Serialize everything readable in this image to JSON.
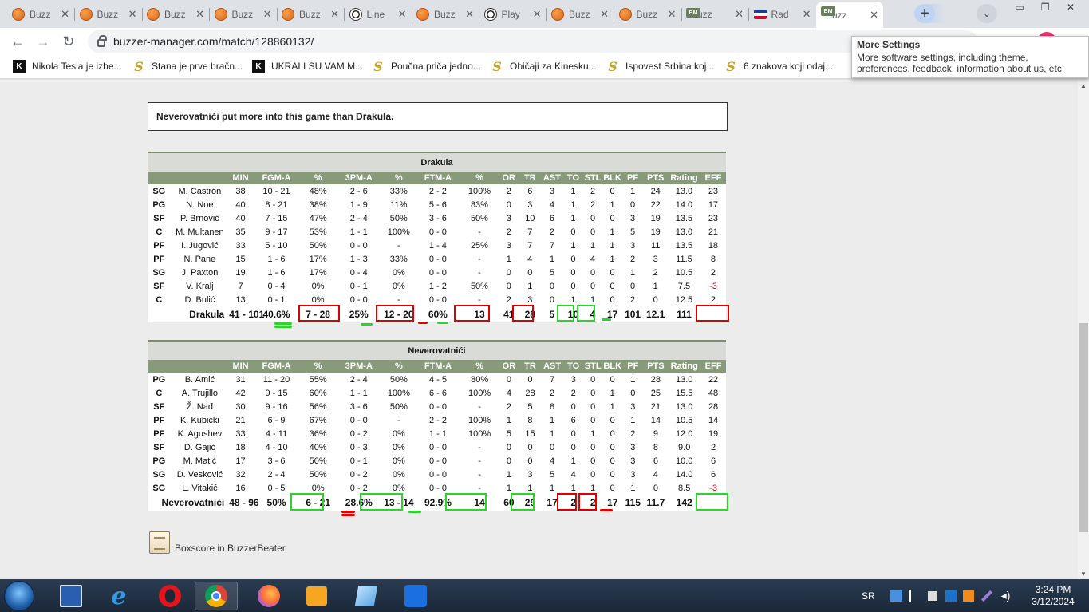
{
  "browser": {
    "tabs": [
      {
        "label": "Buzz",
        "icon": "basketball-icon"
      },
      {
        "label": "Buzz",
        "icon": "basketball-icon"
      },
      {
        "label": "Buzz",
        "icon": "basketball-icon"
      },
      {
        "label": "Buzz",
        "icon": "basketball-icon"
      },
      {
        "label": "Buzz",
        "icon": "basketball-icon"
      },
      {
        "label": "Line",
        "icon": "soccer-ball-icon"
      },
      {
        "label": "Buzz",
        "icon": "basketball-icon"
      },
      {
        "label": "Play",
        "icon": "soccer-ball-icon"
      },
      {
        "label": "Buzz",
        "icon": "basketball-icon"
      },
      {
        "label": "Buzz",
        "icon": "basketball-icon"
      },
      {
        "label": "Buzz",
        "icon": "bm-logo-icon"
      },
      {
        "label": "Rad",
        "icon": "flag-icon"
      },
      {
        "label": "Buzz",
        "icon": "bm-logo-icon",
        "active": true
      }
    ],
    "url": "buzzer-manager.com/match/128860132/",
    "bookmarks": [
      {
        "label": "Nikola Tesla je izbe...",
        "icon": "k"
      },
      {
        "label": "Stana je prve bračn...",
        "icon": "s"
      },
      {
        "label": "UKRALI SU VAM M...",
        "icon": "k"
      },
      {
        "label": "Poučna priča jedno...",
        "icon": "s"
      },
      {
        "label": "Običaji za Kinesku...",
        "icon": "s"
      },
      {
        "label": "Ispovest Srbina koj...",
        "icon": "s"
      },
      {
        "label": "6 znakova koji odaj...",
        "icon": "s"
      }
    ],
    "tooltip": {
      "title": "More Settings",
      "text": "More software settings, including theme, preferences, feedback, information about us, etc."
    }
  },
  "page": {
    "notice": "Neverovatnići put more into this game than Drakula.",
    "columns": [
      "",
      "",
      "MIN",
      "FGM-A",
      "%",
      "3PM-A",
      "%",
      "FTM-A",
      "%",
      "OR",
      "TR",
      "AST",
      "TO",
      "STL",
      "BLK",
      "PF",
      "PTS",
      "Rating",
      "EFF"
    ],
    "teams": [
      {
        "name": "Drakula",
        "players": [
          [
            "SG",
            "M. Castrón",
            "38",
            "10 - 21",
            "48%",
            "2 - 6",
            "33%",
            "2 - 2",
            "100%",
            "2",
            "6",
            "3",
            "1",
            "2",
            "0",
            "1",
            "24",
            "13.0",
            "23"
          ],
          [
            "PG",
            "N. Noe",
            "40",
            "8 - 21",
            "38%",
            "1 - 9",
            "11%",
            "5 - 6",
            "83%",
            "0",
            "3",
            "4",
            "1",
            "2",
            "1",
            "0",
            "22",
            "14.0",
            "17"
          ],
          [
            "SF",
            "P. Brnović",
            "40",
            "7 - 15",
            "47%",
            "2 - 4",
            "50%",
            "3 - 6",
            "50%",
            "3",
            "10",
            "6",
            "1",
            "0",
            "0",
            "3",
            "19",
            "13.5",
            "23"
          ],
          [
            "C",
            "M. Multanen",
            "35",
            "9 - 17",
            "53%",
            "1 - 1",
            "100%",
            "0 - 0",
            "-",
            "2",
            "7",
            "2",
            "0",
            "0",
            "1",
            "5",
            "19",
            "13.0",
            "21"
          ],
          [
            "PF",
            "I. Jugović",
            "33",
            "5 - 10",
            "50%",
            "0 - 0",
            "-",
            "1 - 4",
            "25%",
            "3",
            "7",
            "7",
            "1",
            "1",
            "1",
            "3",
            "11",
            "13.5",
            "18"
          ],
          [
            "PF",
            "N. Pane",
            "15",
            "1 - 6",
            "17%",
            "1 - 3",
            "33%",
            "0 - 0",
            "-",
            "1",
            "4",
            "1",
            "0",
            "4",
            "1",
            "2",
            "3",
            "11.5",
            "8"
          ],
          [
            "SG",
            "J. Paxton",
            "19",
            "1 - 6",
            "17%",
            "0 - 4",
            "0%",
            "0 - 0",
            "-",
            "0",
            "0",
            "5",
            "0",
            "0",
            "0",
            "1",
            "2",
            "10.5",
            "2"
          ],
          [
            "SF",
            "V. Kralj",
            "7",
            "0 - 4",
            "0%",
            "0 - 1",
            "0%",
            "1 - 2",
            "50%",
            "0",
            "1",
            "0",
            "0",
            "0",
            "0",
            "0",
            "1",
            "7.5",
            "-3"
          ],
          [
            "C",
            "D. Bulić",
            "13",
            "0 - 1",
            "0%",
            "0 - 0",
            "-",
            "0 - 0",
            "-",
            "2",
            "3",
            "0",
            "1",
            "1",
            "0",
            "2",
            "0",
            "12.5",
            "2"
          ]
        ],
        "totals": [
          "Drakula",
          "",
          "41 - 101",
          "40.6%",
          "7 - 28",
          "25%",
          "12 - 20",
          "60%",
          "13",
          "41",
          "28",
          "5",
          "10",
          "4",
          "17",
          "101",
          "12.1",
          "111"
        ]
      },
      {
        "name": "Neverovatnići",
        "players": [
          [
            "PG",
            "B. Amić",
            "31",
            "11 - 20",
            "55%",
            "2 - 4",
            "50%",
            "4 - 5",
            "80%",
            "0",
            "0",
            "7",
            "3",
            "0",
            "0",
            "1",
            "28",
            "13.0",
            "22"
          ],
          [
            "C",
            "A. Trujillo",
            "42",
            "9 - 15",
            "60%",
            "1 - 1",
            "100%",
            "6 - 6",
            "100%",
            "4",
            "28",
            "2",
            "2",
            "0",
            "1",
            "0",
            "25",
            "15.5",
            "48"
          ],
          [
            "SF",
            "Ž. Nađ",
            "30",
            "9 - 16",
            "56%",
            "3 - 6",
            "50%",
            "0 - 0",
            "-",
            "2",
            "5",
            "8",
            "0",
            "0",
            "1",
            "3",
            "21",
            "13.0",
            "28"
          ],
          [
            "PF",
            "K. Kubicki",
            "21",
            "6 - 9",
            "67%",
            "0 - 0",
            "-",
            "2 - 2",
            "100%",
            "1",
            "8",
            "1",
            "6",
            "0",
            "0",
            "1",
            "14",
            "10.5",
            "14"
          ],
          [
            "PF",
            "K. Agushev",
            "33",
            "4 - 11",
            "36%",
            "0 - 2",
            "0%",
            "1 - 1",
            "100%",
            "5",
            "15",
            "1",
            "0",
            "1",
            "0",
            "2",
            "9",
            "12.0",
            "19"
          ],
          [
            "SF",
            "D. Gajić",
            "18",
            "4 - 10",
            "40%",
            "0 - 3",
            "0%",
            "0 - 0",
            "-",
            "0",
            "0",
            "0",
            "0",
            "0",
            "0",
            "3",
            "8",
            "9.0",
            "2"
          ],
          [
            "PG",
            "M. Matić",
            "17",
            "3 - 6",
            "50%",
            "0 - 1",
            "0%",
            "0 - 0",
            "-",
            "0",
            "0",
            "4",
            "1",
            "0",
            "0",
            "3",
            "6",
            "10.0",
            "6"
          ],
          [
            "SG",
            "D. Vesković",
            "32",
            "2 - 4",
            "50%",
            "0 - 2",
            "0%",
            "0 - 0",
            "-",
            "1",
            "3",
            "5",
            "4",
            "0",
            "0",
            "3",
            "4",
            "14.0",
            "6"
          ],
          [
            "SG",
            "L. Vitakić",
            "16",
            "0 - 5",
            "0%",
            "0 - 2",
            "0%",
            "0 - 0",
            "-",
            "1",
            "1",
            "1",
            "1",
            "1",
            "0",
            "1",
            "0",
            "8.5",
            "-3"
          ]
        ],
        "totals": [
          "Neverovatnići",
          "",
          "48 - 96",
          "50%",
          "6 - 21",
          "28.6%",
          "13 - 14",
          "92.9%",
          "14",
          "60",
          "29",
          "17",
          "2",
          "2",
          "17",
          "115",
          "11.7",
          "142"
        ]
      }
    ],
    "boxscore_link": "Boxscore in BuzzerBeater"
  },
  "taskbar": {
    "lang": "SR",
    "time": "3:24 PM",
    "date": "3/12/2024"
  }
}
